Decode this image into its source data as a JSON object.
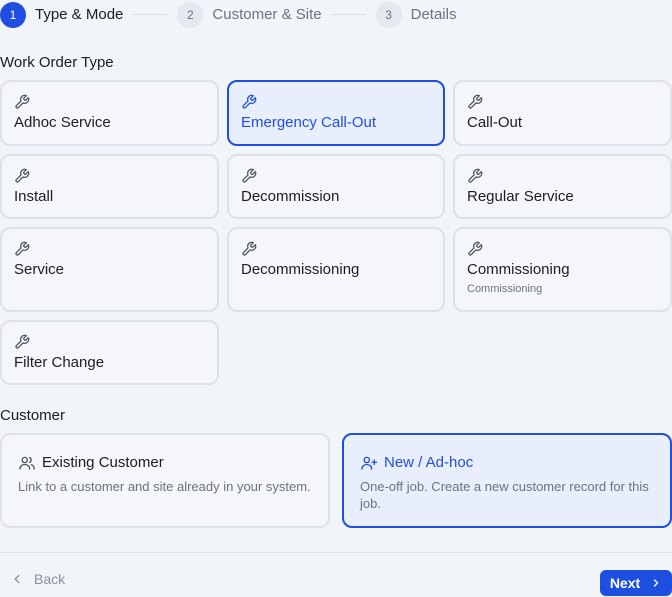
{
  "stepper": {
    "steps": [
      {
        "num": "1",
        "label": "Type & Mode"
      },
      {
        "num": "2",
        "label": "Customer & Site"
      },
      {
        "num": "3",
        "label": "Details"
      }
    ]
  },
  "work_order_type": {
    "section_title": "Work Order Type",
    "selected": "Emergency Call-Out",
    "icon": "wrench-icon",
    "items": [
      {
        "title": "Adhoc Service"
      },
      {
        "title": "Emergency Call-Out"
      },
      {
        "title": "Call-Out"
      },
      {
        "title": "Install"
      },
      {
        "title": "Decommission"
      },
      {
        "title": "Regular Service"
      },
      {
        "title": "Service"
      },
      {
        "title": "Decommissioning"
      },
      {
        "title": "Commissioning",
        "subtitle": "Commissioning"
      },
      {
        "title": "Filter Change"
      }
    ]
  },
  "customer": {
    "section_title": "Customer",
    "selected": "New / Ad-hoc",
    "options": [
      {
        "title": "Existing Customer",
        "desc": "Link to a customer and site already in your system.",
        "icon": "users-icon"
      },
      {
        "title": "New / Ad-hoc",
        "desc_line1": "One-off job. Create a new customer record for this",
        "desc_line2": "job.",
        "icon": "user-plus-icon"
      }
    ]
  },
  "footer": {
    "back_label": "Back",
    "next_label": "Next"
  },
  "colors": {
    "accent": "#1f4fe0",
    "background": "#f1f4f9",
    "border": "#dde1e8",
    "muted_text": "#6b7280"
  }
}
